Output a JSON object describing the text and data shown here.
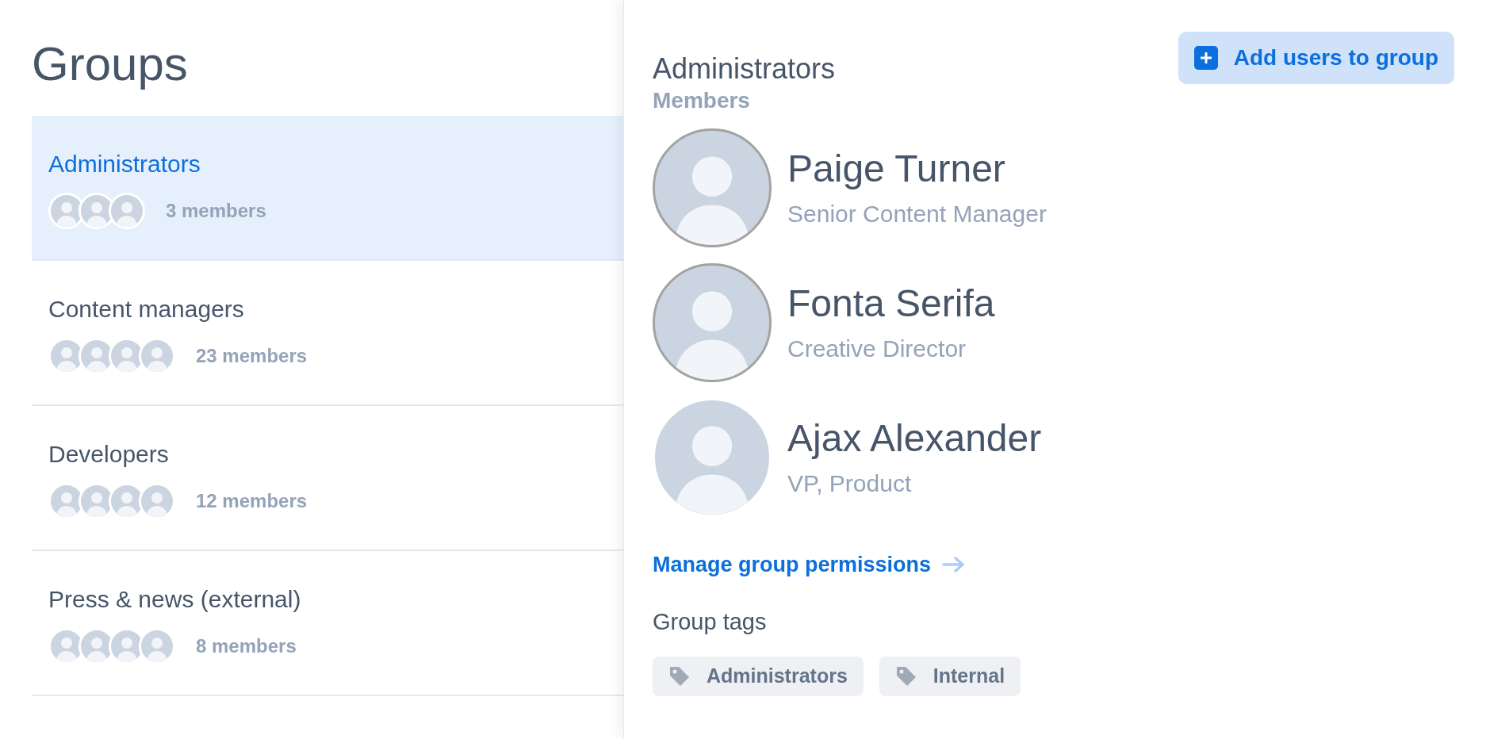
{
  "page_title": "Groups",
  "groups": [
    {
      "name": "Administrators",
      "members": "3 members",
      "selected": true,
      "avatars": [
        {
          "kind": "photo"
        },
        {
          "kind": "photo"
        },
        {
          "kind": "photo"
        }
      ]
    },
    {
      "name": "Content managers",
      "members": "23 members",
      "selected": false,
      "avatars": [
        {
          "kind": "photo"
        },
        {
          "kind": "photo"
        },
        {
          "kind": "photo"
        },
        {
          "kind": "photo"
        }
      ]
    },
    {
      "name": "Developers",
      "members": "12 members",
      "selected": false,
      "avatars": [
        {
          "kind": "photo"
        },
        {
          "kind": "photo"
        },
        {
          "kind": "photo"
        },
        {
          "kind": "photo"
        }
      ]
    },
    {
      "name": "Press & news (external)",
      "members": "8 members",
      "selected": false,
      "avatars": [
        {
          "kind": "photo"
        },
        {
          "kind": "photo"
        },
        {
          "kind": "photo"
        },
        {
          "kind": "photo"
        }
      ]
    }
  ],
  "detail": {
    "title": "Administrators",
    "add_button": "Add users to group",
    "members_label": "Members",
    "members": [
      {
        "name": "Paige Turner",
        "role": "Senior Content Manager",
        "ringed": true
      },
      {
        "name": "Fonta Serifa",
        "role": "Creative Director",
        "ringed": true
      },
      {
        "name": "Ajax Alexander",
        "role": "VP, Product",
        "ringed": false
      }
    ],
    "permissions_link": "Manage group permissions",
    "tags_label": "Group tags",
    "tags": [
      "Administrators",
      "Internal"
    ]
  }
}
